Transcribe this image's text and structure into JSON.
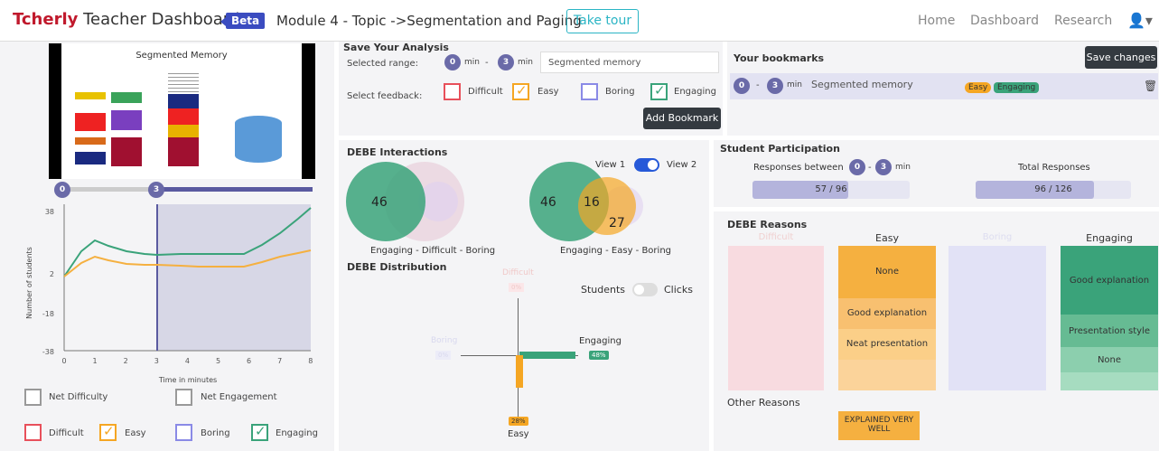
{
  "nav": {
    "brand_a": "Tcherly",
    "brand_b": " Teacher Dashboard",
    "beta": "Beta",
    "module": "Module 4 - Topic ->Segmentation and Paging",
    "tour": "Take tour",
    "home": "Home",
    "dashboard": "Dashboard",
    "research": "Research"
  },
  "video": {
    "title": "Segmented Memory",
    "slider_start": "0",
    "slider_pos": "3"
  },
  "linechart": {
    "ylabel": "Number of students",
    "xlabel": "Time in minutes",
    "yticks": [
      "38",
      "2",
      "-18",
      "-38"
    ],
    "xticks": [
      "0",
      "1",
      "2",
      "3",
      "4",
      "5",
      "6",
      "7",
      "8"
    ]
  },
  "legend": {
    "net_difficulty": "Net Difficulty",
    "net_engagement": "Net Engagement",
    "difficult": "Difficult",
    "easy": "Easy",
    "boring": "Boring",
    "engaging": "Engaging"
  },
  "save": {
    "title": "Save Your Analysis",
    "range_label": "Selected range:",
    "from": "0",
    "to": "3",
    "min": "min",
    "dash": "-",
    "name": "Segmented memory",
    "feedback_label": "Select feedback:",
    "difficult": "Difficult",
    "easy": "Easy",
    "boring": "Boring",
    "engaging": "Engaging",
    "add": "Add Bookmark"
  },
  "bookmarks": {
    "title": "Your bookmarks",
    "save": "Save changes",
    "from": "0",
    "to": "3",
    "min": "min",
    "name": "Segmented memory",
    "tags": [
      "Easy",
      "Engaging"
    ]
  },
  "debe": {
    "title": "DEBE Interactions",
    "v1_num": "46",
    "v1_label": "Engaging - Difficult - Boring",
    "v2_a": "46",
    "v2_b": "16",
    "v2_c": "27",
    "v2_label": "Engaging - Easy - Boring",
    "view1": "View 1",
    "view2": "View 2",
    "dist_title": "DEBE Distribution",
    "students": "Students",
    "clicks": "Clicks",
    "engaging": "Engaging",
    "engaging_pct": "48%",
    "easy": "Easy",
    "easy_pct": "28%",
    "difficult": "Difficult",
    "difficult_pct": "0%",
    "boring": "Boring",
    "boring_pct": "0%"
  },
  "participation": {
    "title": "Student Participation",
    "responses_between": "Responses between",
    "from": "0",
    "to": "3",
    "min": "min",
    "total_label": "Total Responses",
    "bar1": "57 / 96",
    "bar2": "96 / 126",
    "bar1_frac": 0.61,
    "bar2_frac": 0.76
  },
  "reasons": {
    "title": "DEBE Reasons",
    "cols": [
      "Difficult",
      "Easy",
      "Boring",
      "Engaging"
    ],
    "easy": [
      "None",
      "Good explanation",
      "Neat presentation"
    ],
    "engaging": [
      "Good explanation",
      "Presentation style",
      "None"
    ],
    "other_title": "Other Reasons",
    "other": "EXPLAINED VERY WELL"
  },
  "colors": {
    "difficult": "#e8505b",
    "easy": "#f5a623",
    "boring": "#8a8ae6",
    "engaging": "#3aa37a",
    "accent": "#5a5aa0"
  }
}
